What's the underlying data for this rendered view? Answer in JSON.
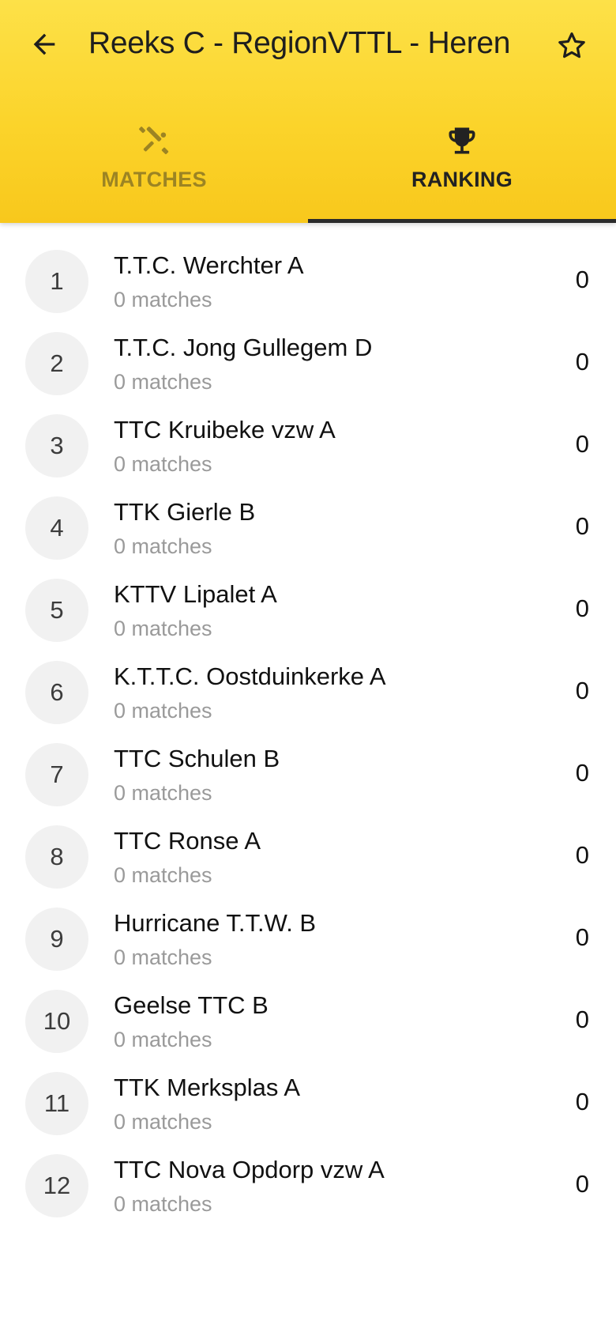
{
  "header": {
    "title": "Reeks C - RegionVTTL - Heren",
    "back_icon": "arrow-left-icon",
    "favorite_icon": "star-outline-icon"
  },
  "tabs": [
    {
      "label": "MATCHES",
      "icon": "ping-pong-paddles-icon",
      "active": false
    },
    {
      "label": "RANKING",
      "icon": "trophy-icon",
      "active": true
    }
  ],
  "colors": {
    "accent": "#fbd42b",
    "accent_top": "#fde148",
    "inactive_tab": "#9c8423",
    "indicator": "#2b2b2b",
    "rank_circle": "#f1f1f1",
    "secondary_text": "#9a9a9a"
  },
  "ranking": [
    {
      "rank": "1",
      "team": "T.T.C. Werchter A",
      "matches": "0 matches",
      "points": "0"
    },
    {
      "rank": "2",
      "team": "T.T.C. Jong Gullegem D",
      "matches": "0 matches",
      "points": "0"
    },
    {
      "rank": "3",
      "team": "TTC Kruibeke vzw A",
      "matches": "0 matches",
      "points": "0"
    },
    {
      "rank": "4",
      "team": "TTK Gierle B",
      "matches": "0 matches",
      "points": "0"
    },
    {
      "rank": "5",
      "team": "KTTV Lipalet A",
      "matches": "0 matches",
      "points": "0"
    },
    {
      "rank": "6",
      "team": "K.T.T.C. Oostduinkerke A",
      "matches": "0 matches",
      "points": "0"
    },
    {
      "rank": "7",
      "team": "TTC Schulen B",
      "matches": "0 matches",
      "points": "0"
    },
    {
      "rank": "8",
      "team": "TTC Ronse A",
      "matches": "0 matches",
      "points": "0"
    },
    {
      "rank": "9",
      "team": "Hurricane T.T.W. B",
      "matches": "0 matches",
      "points": "0"
    },
    {
      "rank": "10",
      "team": "Geelse TTC B",
      "matches": "0 matches",
      "points": "0"
    },
    {
      "rank": "11",
      "team": "TTK Merksplas A",
      "matches": "0 matches",
      "points": "0"
    },
    {
      "rank": "12",
      "team": "TTC Nova Opdorp vzw A",
      "matches": "0 matches",
      "points": "0"
    }
  ]
}
